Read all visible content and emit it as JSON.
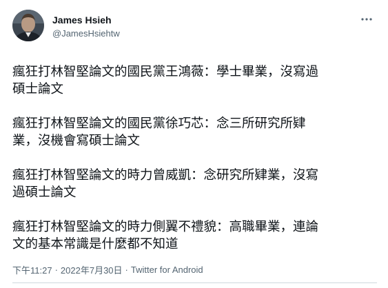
{
  "author": {
    "name": "James Hsieh",
    "handle": "@JamesHsiehtw",
    "avatar_icon": "profile-photo"
  },
  "more_icon": "more-options-icon",
  "tweet": {
    "paragraphs": [
      "瘋狂打林智堅論文的國民黨王鴻薇：學士畢業，沒寫過\n碩士論文",
      "瘋狂打林智堅論文的國民黨徐巧芯：念三所研究所肄\n業，沒機會寫碩士論文",
      "瘋狂打林智堅論文的時力曾威凱：念研究所肄業，沒寫\n過碩士論文",
      "瘋狂打林智堅論文的時力側翼不禮貌：高職畢業，連論\n文的基本常識是什麼都不知道"
    ]
  },
  "meta": {
    "time": "下午11:27",
    "separator": "·",
    "date": "2022年7月30日",
    "source": "Twitter for Android"
  },
  "colors": {
    "text": "#0f1419",
    "secondary": "#536471",
    "divider": "#cfd9de"
  }
}
